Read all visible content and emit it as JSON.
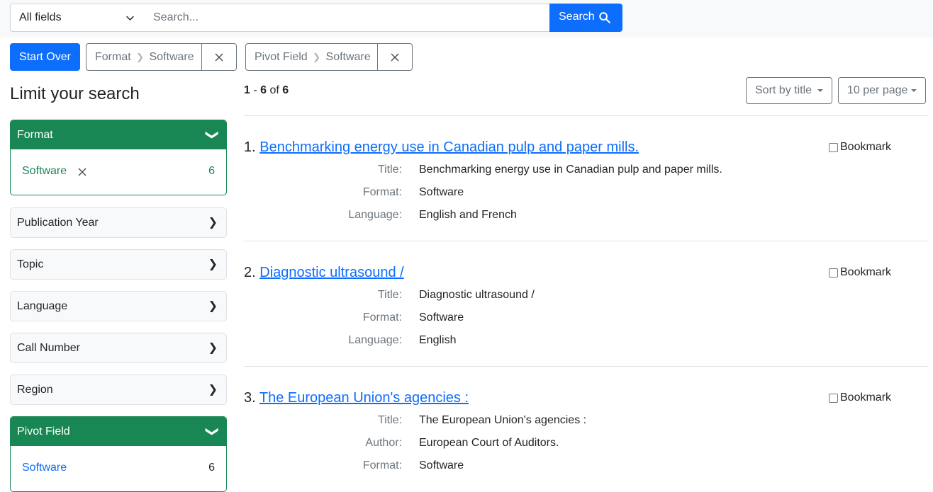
{
  "search": {
    "field_select": "All fields",
    "placeholder": "Search...",
    "button_label": "Search"
  },
  "constraints": {
    "start_over": "Start Over",
    "items": [
      {
        "field": "Format",
        "separator": "❯",
        "value": "Software"
      },
      {
        "field": "Pivot Field",
        "separator": "❯",
        "value": "Software"
      }
    ]
  },
  "sidebar": {
    "heading": "Limit your search",
    "facets": [
      {
        "label": "Format",
        "open": true,
        "arrow": "❯",
        "selected": {
          "label": "Software",
          "count": "6"
        }
      },
      {
        "label": "Publication Year",
        "open": false,
        "arrow": "❯"
      },
      {
        "label": "Topic",
        "open": false,
        "arrow": "❯"
      },
      {
        "label": "Language",
        "open": false,
        "arrow": "❯"
      },
      {
        "label": "Call Number",
        "open": false,
        "arrow": "❯"
      },
      {
        "label": "Region",
        "open": false,
        "arrow": "❯"
      },
      {
        "label": "Pivot Field",
        "open": true,
        "arrow": "❯",
        "item": {
          "label": "Software",
          "count": "6"
        }
      }
    ]
  },
  "results": {
    "range_start": "1",
    "range_sep": " - ",
    "range_end": "6",
    "of": " of ",
    "total": "6",
    "sort_label": "Sort by title",
    "per_page_label": "10 per page",
    "bookmark_label": "Bookmark",
    "docs": [
      {
        "index": "1.",
        "title": "Benchmarking energy use in Canadian pulp and paper mills.",
        "fields": [
          {
            "key": "Title:",
            "value": "Benchmarking energy use in Canadian pulp and paper mills."
          },
          {
            "key": "Format:",
            "value": "Software"
          },
          {
            "key": "Language:",
            "value": "English and French"
          }
        ]
      },
      {
        "index": "2.",
        "title": "Diagnostic ultrasound /",
        "fields": [
          {
            "key": "Title:",
            "value": "Diagnostic ultrasound /"
          },
          {
            "key": "Format:",
            "value": "Software"
          },
          {
            "key": "Language:",
            "value": "English"
          }
        ]
      },
      {
        "index": "3.",
        "title": "The European Union's agencies :",
        "fields": [
          {
            "key": "Title:",
            "value": "The European Union's agencies :"
          },
          {
            "key": "Author:",
            "value": "European Court of Auditors."
          },
          {
            "key": "Format:",
            "value": "Software"
          }
        ]
      }
    ]
  },
  "colors": {
    "primary": "#0d6efd",
    "facet_active": "#198754",
    "muted": "#6c757d"
  }
}
